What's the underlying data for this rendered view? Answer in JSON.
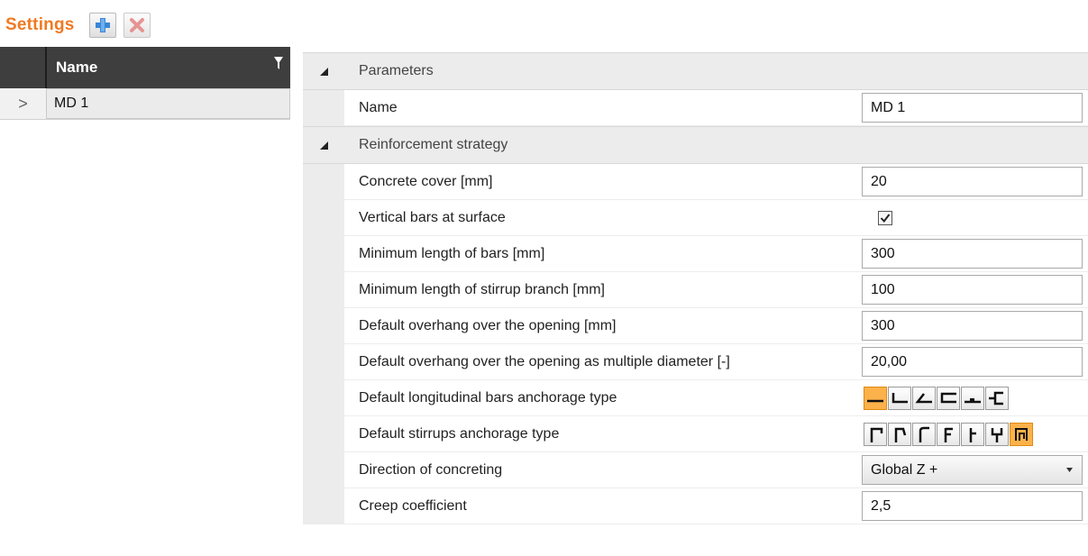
{
  "header": {
    "title": "Settings",
    "add_label": "Add",
    "delete_label": "Delete"
  },
  "grid": {
    "column_name": "Name",
    "rows": [
      {
        "indicator": ">",
        "name": "MD 1"
      }
    ]
  },
  "props": {
    "categories": [
      {
        "label": "Parameters",
        "rows": [
          {
            "label": "Name",
            "value": "MD 1"
          }
        ]
      },
      {
        "label": "Reinforcement strategy",
        "rows": [
          {
            "label": "Concrete cover [mm]",
            "value": "20"
          },
          {
            "label": "Vertical bars at surface",
            "checked": true
          },
          {
            "label": "Minimum length of bars [mm]",
            "value": "300"
          },
          {
            "label": "Minimum length of stirrup branch [mm]",
            "value": "100"
          },
          {
            "label": "Default overhang over the opening [mm]",
            "value": "300"
          },
          {
            "label": "Default overhang over the opening as multiple diameter [-]",
            "value": "20,00"
          },
          {
            "label": "Default longitudinal bars anchorage type",
            "options": [
              "straight-end-icon",
              "hook-90-icon",
              "hook-135-icon",
              "hook-180-icon",
              "welded-bar-icon",
              "anchor-plate-icon"
            ],
            "selected_index": 0
          },
          {
            "label": "Default stirrups anchorage type",
            "options": [
              "stirrup-hook-90-icon",
              "stirrup-hook-135-icon",
              "stirrup-hook-180-icon",
              "stirrup-lap-icon",
              "stirrup-bend-icon",
              "stirrup-fork-icon",
              "stirrup-closed-icon"
            ],
            "selected_index": 6
          },
          {
            "label": "Direction of concreting",
            "value": "Global Z +"
          },
          {
            "label": "Creep coefficient",
            "value": "2,5"
          }
        ]
      }
    ]
  },
  "colors": {
    "accent": "#f07a22",
    "selected": "#fcb24a",
    "grid_header": "#3e3e3e",
    "category": "#ececec"
  }
}
